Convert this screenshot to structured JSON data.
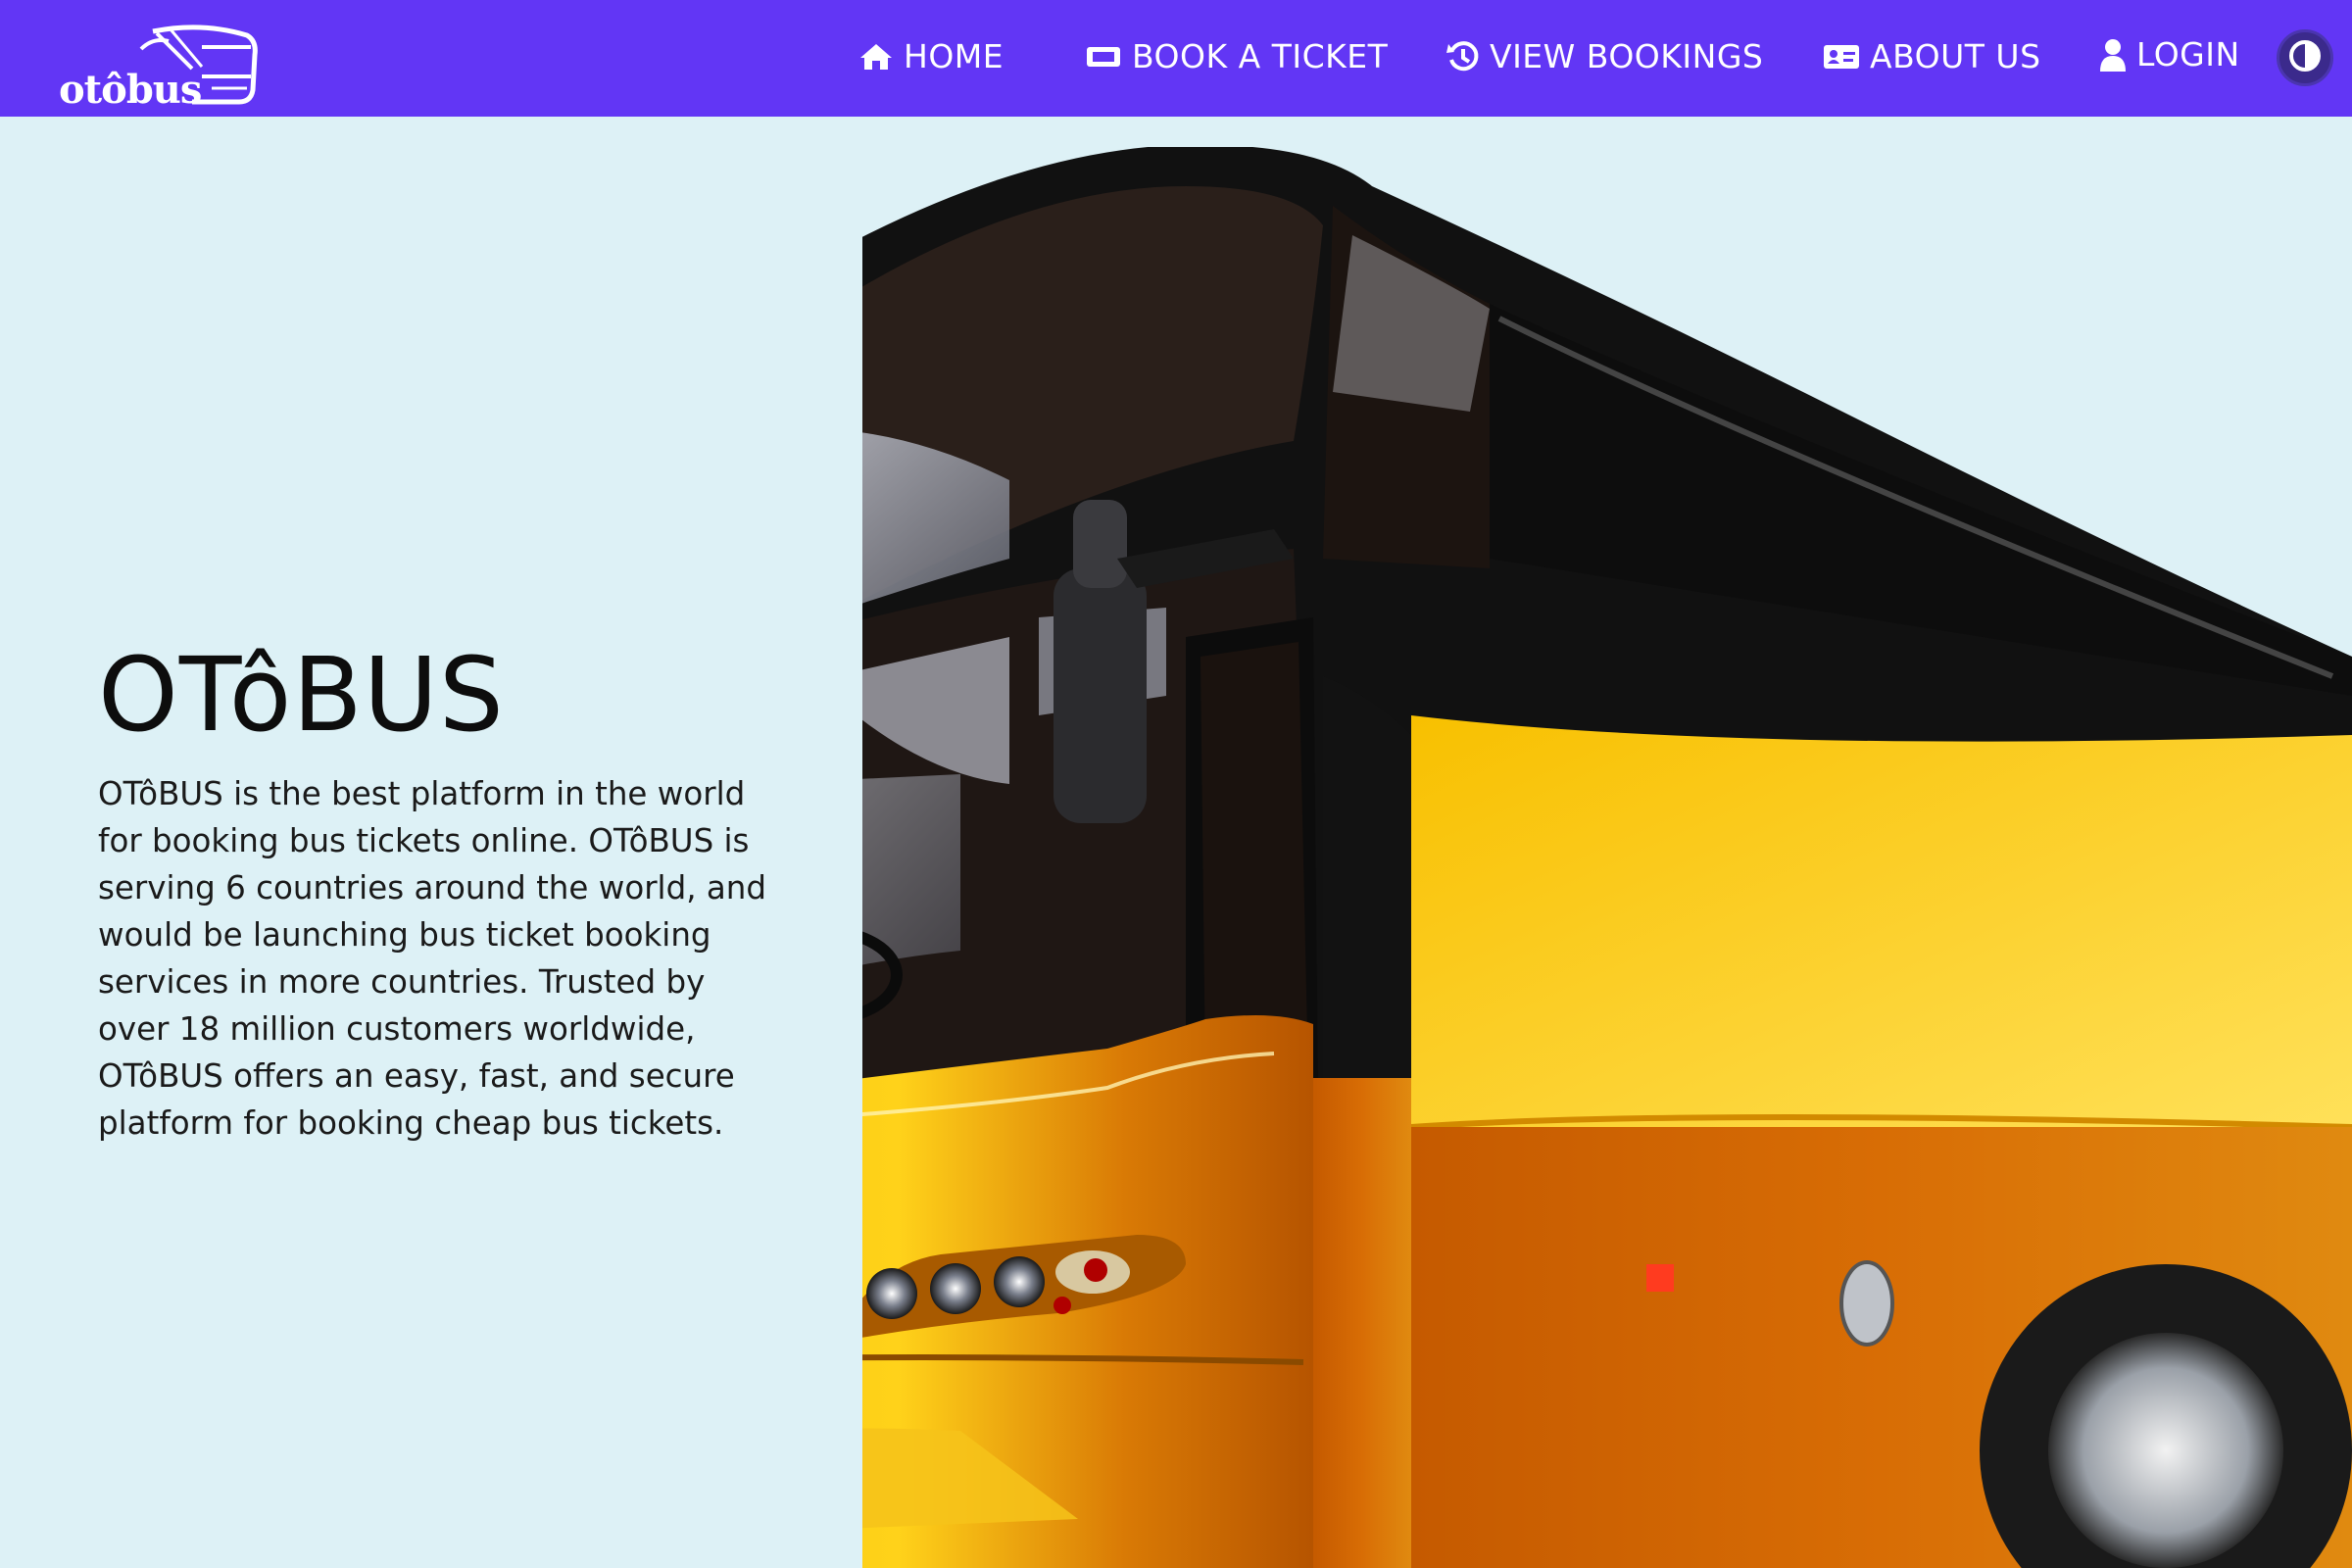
{
  "brand": {
    "name": "otôbus"
  },
  "nav": {
    "home": "HOME",
    "book": "BOOK A TICKET",
    "view": "VIEW BOOKINGS",
    "about": "ABOUT US",
    "login": "LOGIN"
  },
  "hero": {
    "title": "OTôBUS",
    "description": "OTôBUS is the best platform in the world for booking bus tickets online. OTôBUS is serving 6 countries around the world, and would be launching bus ticket booking services in more countries. Trusted by over 18 million customers worldwide, OTôBUS offers an easy, fast, and secure platform for booking cheap bus tickets."
  },
  "icons": {
    "home": "home-icon",
    "book": "ticket-icon",
    "view": "history-icon",
    "about": "id-card-icon",
    "login": "user-icon",
    "theme": "contrast-icon"
  },
  "colors": {
    "navbar": "#6236f5",
    "background": "#ddf1f6",
    "bus_yellow": "#f2b705",
    "bus_orange": "#c8650a"
  }
}
